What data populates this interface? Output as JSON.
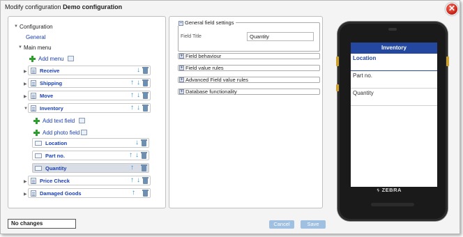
{
  "dialog": {
    "title_prefix": "Modify configuration",
    "title_name": "Demo configuration",
    "close_label": "✕"
  },
  "tree": {
    "root_label": "Configuration",
    "general_label": "General",
    "main_menu_label": "Main menu",
    "add_menu_label": "Add menu",
    "menus": [
      {
        "label": "Receive"
      },
      {
        "label": "Shipping"
      },
      {
        "label": "Move"
      },
      {
        "label": "Inventory"
      }
    ],
    "add_text_field_label": "Add text field",
    "add_photo_field_label": "Add photo field",
    "fields": [
      {
        "label": "Location"
      },
      {
        "label": "Part no."
      },
      {
        "label": "Quantity"
      }
    ],
    "more_menus": [
      {
        "label": "Price Check"
      },
      {
        "label": "Damaged Goods"
      }
    ]
  },
  "settings": {
    "general_header": "General field settings",
    "field_title_label": "Field Title",
    "field_title_value": "Quantity",
    "sections": [
      "Field behaviour",
      "Field value rules",
      "Advanced Field value rules",
      "Database functionality"
    ]
  },
  "footer": {
    "status": "No changes",
    "cancel_label": "Cancel",
    "save_label": "Save"
  },
  "preview": {
    "screen_title": "Inventory",
    "rows": [
      "Location",
      "Part no.",
      "Quantity"
    ],
    "brand": "ZEBRA"
  }
}
